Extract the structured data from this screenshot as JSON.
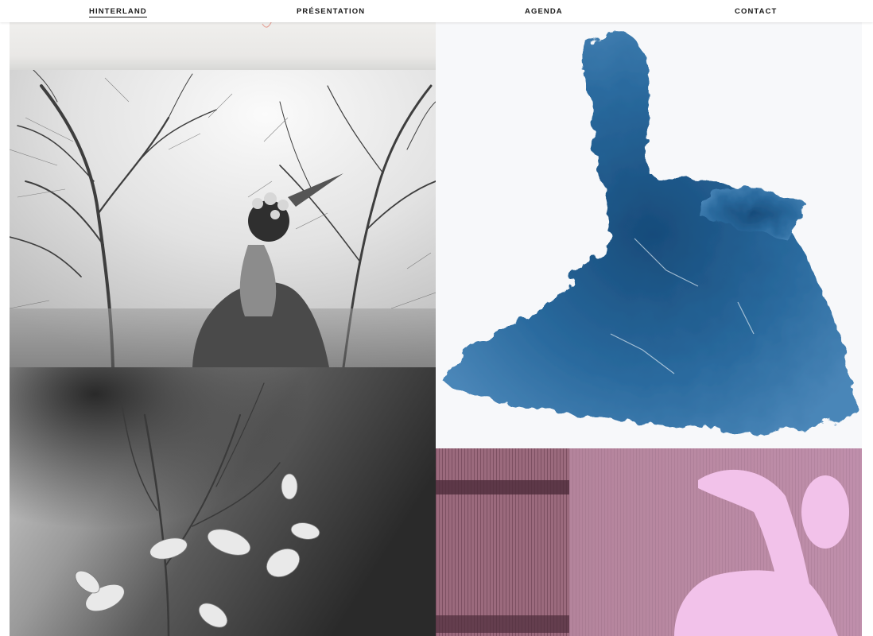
{
  "nav": {
    "items": [
      {
        "label": "HINTERLAND",
        "active": true
      },
      {
        "label": "PRÉSENTATION",
        "active": false
      },
      {
        "label": "AGENDA",
        "active": false
      },
      {
        "label": "CONTACT",
        "active": false
      }
    ]
  },
  "colors": {
    "nav_text": "#1a1a1a",
    "cyanotype_blue": "#1f5a8c",
    "pink_tint": "#d9a3d3"
  }
}
